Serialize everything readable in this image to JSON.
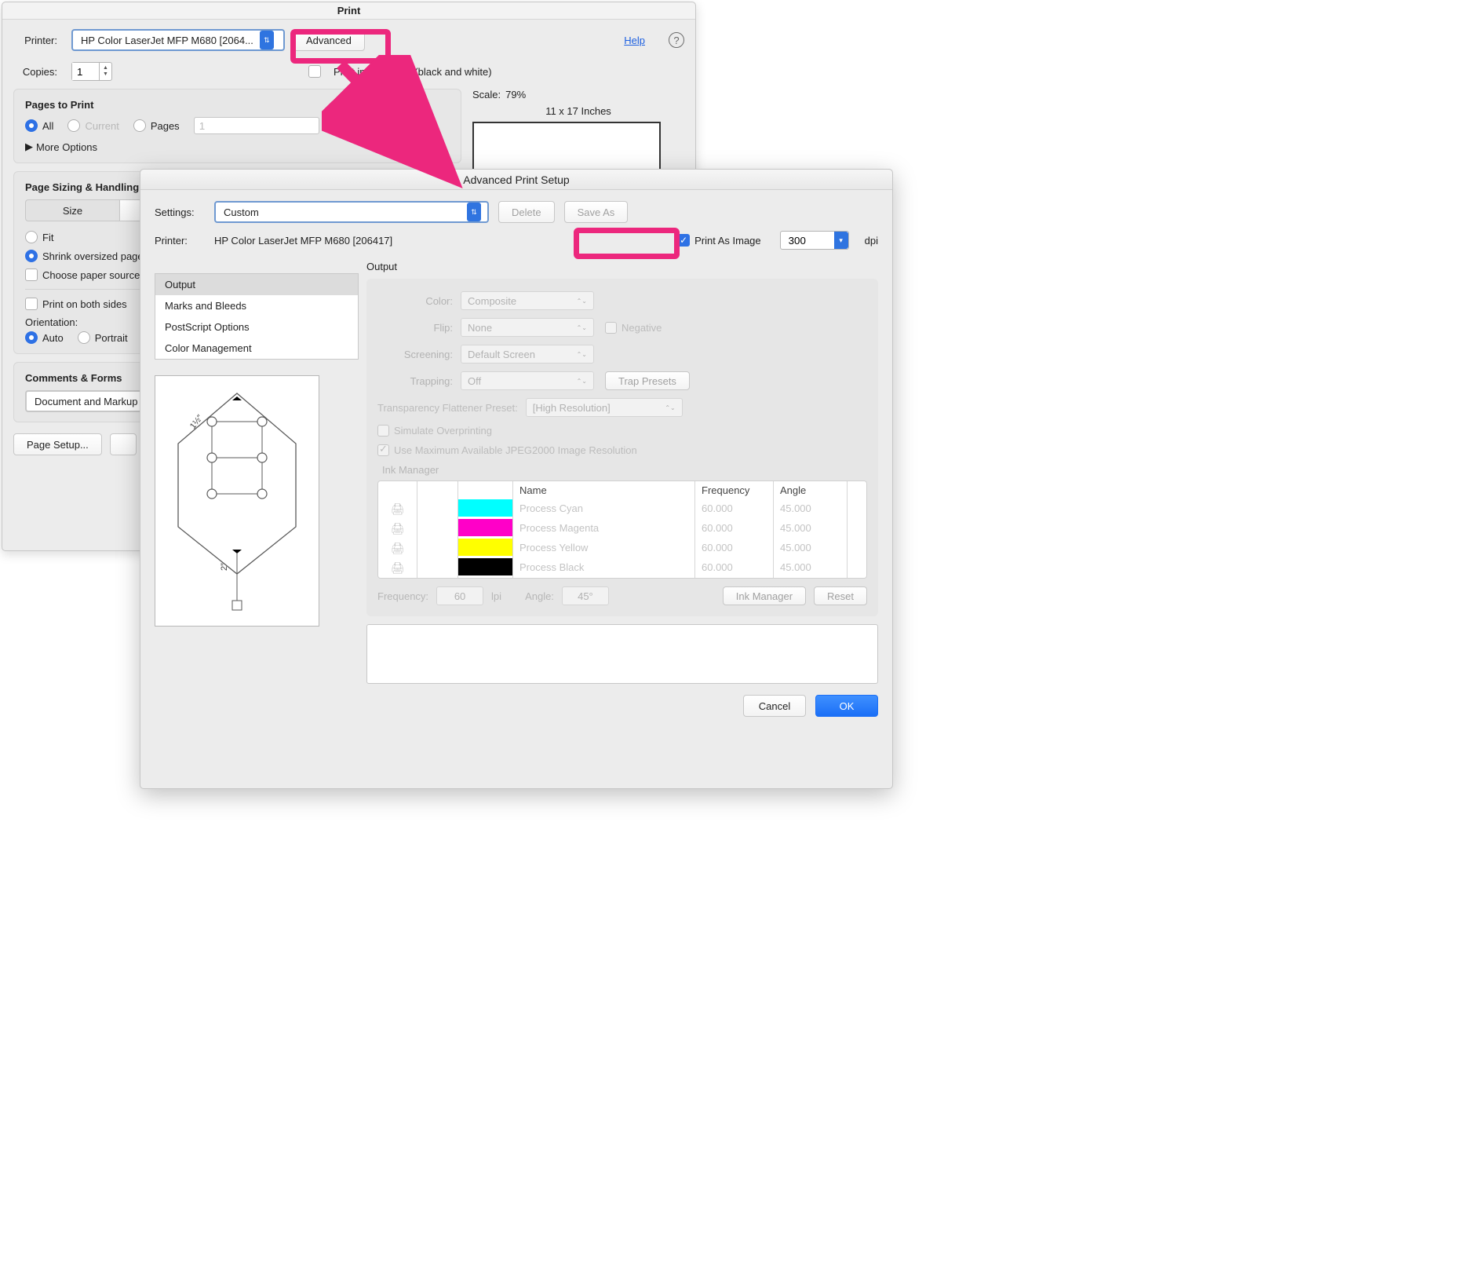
{
  "print": {
    "title": "Print",
    "printer_label": "Printer:",
    "printer_value": "HP Color LaserJet MFP M680 [2064...",
    "advanced": "Advanced",
    "help": "Help",
    "copies_label": "Copies:",
    "copies_value": "1",
    "grayscale": "Print in grayscale (black and white)",
    "pages_panel_title": "Pages to Print",
    "radio_all": "All",
    "radio_current": "Current",
    "radio_pages": "Pages",
    "pages_value": "1",
    "more_options": "More Options",
    "sizing_panel_title": "Page Sizing & Handling",
    "seg_size": "Size",
    "radio_fit": "Fit",
    "radio_shrink": "Shrink oversized pages",
    "choose_source": "Choose paper source",
    "both_sides": "Print on both sides",
    "orientation_label": "Orientation:",
    "radio_auto": "Auto",
    "radio_portrait": "Portrait",
    "comments_title": "Comments & Forms",
    "comments_value": "Document and Markup",
    "page_setup": "Page Setup...",
    "scale_label": "Scale:",
    "scale_value": "79%",
    "paper_size": "11 x 17 Inches"
  },
  "adv": {
    "title": "Advanced Print Setup",
    "settings_label": "Settings:",
    "settings_value": "Custom",
    "delete": "Delete",
    "save_as": "Save As",
    "printer_label": "Printer:",
    "printer_value": "HP Color LaserJet MFP M680 [206417]",
    "print_as_image": "Print As Image",
    "dpi_value": "300",
    "dpi_label": "dpi",
    "side": [
      "Output",
      "Marks and Bleeds",
      "PostScript Options",
      "Color Management"
    ],
    "output_title": "Output",
    "color_label": "Color:",
    "color_value": "Composite",
    "flip_label": "Flip:",
    "flip_value": "None",
    "negative": "Negative",
    "screening_label": "Screening:",
    "screening_value": "Default Screen",
    "trapping_label": "Trapping:",
    "trapping_value": "Off",
    "trap_presets": "Trap Presets",
    "tfp_label": "Transparency Flattener Preset:",
    "tfp_value": "[High Resolution]",
    "sim_overprint": "Simulate Overprinting",
    "use_jpeg2000": "Use Maximum Available JPEG2000 Image Resolution",
    "ink_manager": "Ink Manager",
    "th_name": "Name",
    "th_freq": "Frequency",
    "th_angle": "Angle",
    "inks": [
      {
        "name": "Process Cyan",
        "color": "#00FFFF",
        "freq": "60.000",
        "angle": "45.000"
      },
      {
        "name": "Process Magenta",
        "color": "#FF00C8",
        "freq": "60.000",
        "angle": "45.000"
      },
      {
        "name": "Process Yellow",
        "color": "#FFFF00",
        "freq": "60.000",
        "angle": "45.000"
      },
      {
        "name": "Process Black",
        "color": "#000000",
        "freq": "60.000",
        "angle": "45.000"
      }
    ],
    "foot_freq_label": "Frequency:",
    "foot_freq_value": "60",
    "lpi": "lpi",
    "foot_angle_label": "Angle:",
    "foot_angle_value": "45°",
    "ink_manager_btn": "Ink Manager",
    "reset_btn": "Reset",
    "cancel": "Cancel",
    "ok": "OK"
  },
  "thumb": {
    "dim1": "1½″",
    "dim2": "2″"
  }
}
